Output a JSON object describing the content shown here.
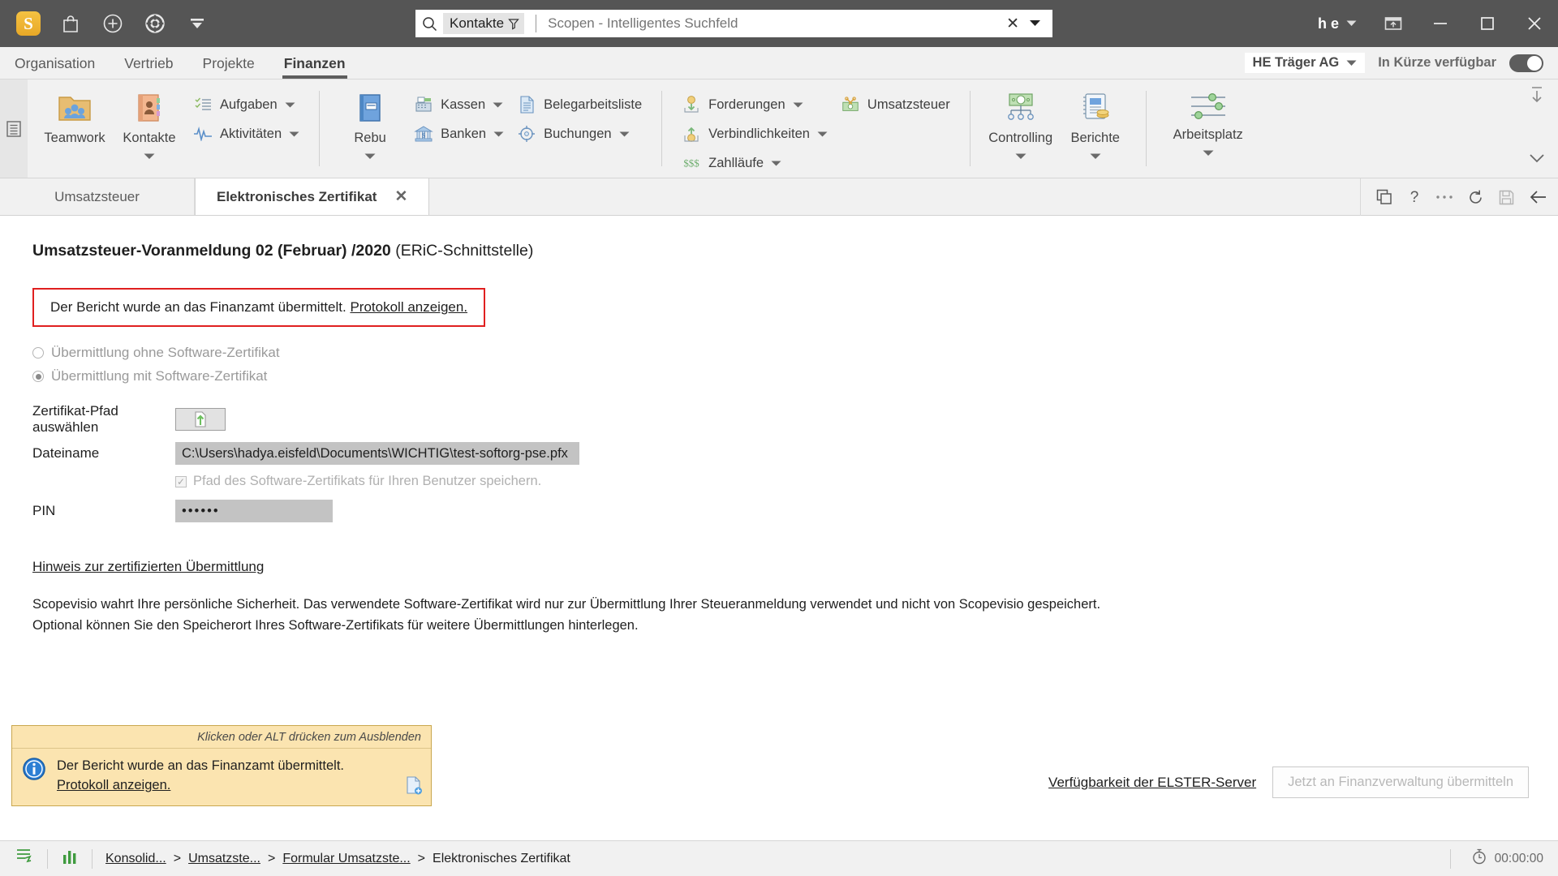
{
  "titlebar": {
    "icons": [
      {
        "name": "scopevisio-logo",
        "glyph": "S"
      },
      {
        "name": "shop-bag-icon"
      },
      {
        "name": "plus-circle-icon"
      },
      {
        "name": "lifering-help-icon"
      },
      {
        "name": "filter-collapse-icon"
      }
    ],
    "search": {
      "scope_chip": "Kontakte",
      "value": "",
      "placeholder": "Scopen - Intelligentes Suchfeld"
    },
    "user": "h e",
    "window_buttons": [
      "restore-down",
      "minimize",
      "maximize",
      "close"
    ]
  },
  "menubar": {
    "items": [
      {
        "label": "Organisation",
        "active": false
      },
      {
        "label": "Vertrieb",
        "active": false
      },
      {
        "label": "Projekte",
        "active": false
      },
      {
        "label": "Finanzen",
        "active": true
      }
    ],
    "company": "HE Träger AG",
    "availability_label": "In Kürze verfügbar",
    "availability_on": true
  },
  "ribbon": {
    "groups": [
      {
        "big": [
          {
            "label": "Teamwork",
            "icon": "teamwork-folder-icon",
            "has_dropdown": false
          },
          {
            "label": "Kontakte",
            "icon": "contacts-book-icon",
            "has_dropdown": true
          }
        ],
        "small": [
          {
            "label": "Aufgaben",
            "icon": "tasks-list-icon",
            "has_dropdown": true
          },
          {
            "label": "Aktivitäten",
            "icon": "activity-pulse-icon",
            "has_dropdown": true
          }
        ]
      },
      {
        "big": [
          {
            "label": "Rebu",
            "icon": "ledger-book-icon",
            "has_dropdown": true
          }
        ],
        "small": [
          {
            "label": "Kassen",
            "icon": "cash-register-icon",
            "has_dropdown": true
          },
          {
            "label": "Banken",
            "icon": "bank-icon",
            "has_dropdown": true
          }
        ],
        "small2": [
          {
            "label": "Belegarbeitsliste",
            "icon": "document-list-icon",
            "has_dropdown": false
          },
          {
            "label": "Buchungen",
            "icon": "booking-target-icon",
            "has_dropdown": true
          }
        ]
      },
      {
        "small": [
          {
            "label": "Forderungen",
            "icon": "receivables-icon",
            "has_dropdown": true
          },
          {
            "label": "Verbindlichkeiten",
            "icon": "payables-icon",
            "has_dropdown": true
          },
          {
            "label": "Zahlläufe",
            "icon": "payment-runs-icon",
            "has_dropdown": true
          }
        ],
        "small2": [
          {
            "label": "Umsatzsteuer",
            "icon": "vat-money-icon",
            "has_dropdown": false
          }
        ]
      },
      {
        "big": [
          {
            "label": "Controlling",
            "icon": "controlling-chart-icon",
            "has_dropdown": true
          },
          {
            "label": "Berichte",
            "icon": "reports-icon",
            "has_dropdown": true
          }
        ]
      },
      {
        "big": [
          {
            "label": "Arbeitsplatz",
            "icon": "workplace-sliders-icon",
            "has_dropdown": true
          }
        ]
      }
    ]
  },
  "tabstrip": {
    "tabs": [
      {
        "label": "Umsatzsteuer",
        "active": false,
        "closable": false
      },
      {
        "label": "Elektronisches Zertifikat",
        "active": true,
        "closable": true
      }
    ],
    "tools": [
      {
        "name": "duplicate-icon"
      },
      {
        "name": "help-question-icon"
      },
      {
        "name": "more-options-icon"
      },
      {
        "name": "refresh-icon"
      },
      {
        "name": "save-icon"
      },
      {
        "name": "back-arrow-icon"
      }
    ]
  },
  "main": {
    "title_bold": "Umsatzsteuer-Voranmeldung 02 (Februar) /2020",
    "title_sub": " (ERiC-Schnittstelle)",
    "alert": {
      "text": "Der Bericht wurde an das Finanzamt übermittelt.",
      "link": "Protokoll anzeigen.",
      "border_color": "#e02020"
    },
    "radios": [
      {
        "label": "Übermittlung ohne Software-Zertifikat",
        "selected": false
      },
      {
        "label": "Übermittlung mit Software-Zertifikat",
        "selected": true
      }
    ],
    "fields": {
      "cert_path_label": "Zertifikat-Pfad auswählen",
      "browse_icon": "upload-file-icon",
      "filename_label": "Dateiname",
      "filename_value": "C:\\Users\\hadya.eisfeld\\Documents\\WICHTIG\\test-softorg-pse.pfx",
      "save_path_checkbox_label": "Pfad des Software-Zertifikats für Ihren Benutzer speichern.",
      "save_path_checked": true,
      "pin_label": "PIN",
      "pin_value": "••••••"
    },
    "hint_link": "Hinweis zur zertifizierten Übermittlung",
    "body_line1": "Scopevisio wahrt Ihre persönliche Sicherheit. Das verwendete Software-Zertifikat wird nur zur Übermittlung Ihrer Steueranmeldung verwendet und nicht von Scopevisio gespeichert.",
    "body_line2": "Optional können Sie den Speicherort Ihres Software-Zertifikats für weitere Übermittlungen hinterlegen."
  },
  "toast": {
    "hint": "Klicken oder ALT drücken zum Ausblenden",
    "message": "Der Bericht wurde an das Finanzamt übermittelt.",
    "link": "Protokoll anzeigen.",
    "icon": "info-circle-icon",
    "bg_color": "#fbe4b0"
  },
  "footer": {
    "elster_link": "Verfügbarkeit der ELSTER-Server",
    "submit_button": "Jetzt an Finanzverwaltung übermitteln"
  },
  "statusbar": {
    "icons": [
      {
        "name": "journal-icon"
      },
      {
        "name": "bar-chart-icon"
      }
    ],
    "breadcrumbs": [
      {
        "label": "Konsolid...",
        "link": true
      },
      {
        "label": "Umsatzste...",
        "link": true
      },
      {
        "label": "Formular Umsatzste...",
        "link": true
      },
      {
        "label": "Elektronisches Zertifikat",
        "link": false
      }
    ],
    "separator": ">",
    "timer_icon": "stopwatch-icon",
    "timer": "00:00:00"
  }
}
